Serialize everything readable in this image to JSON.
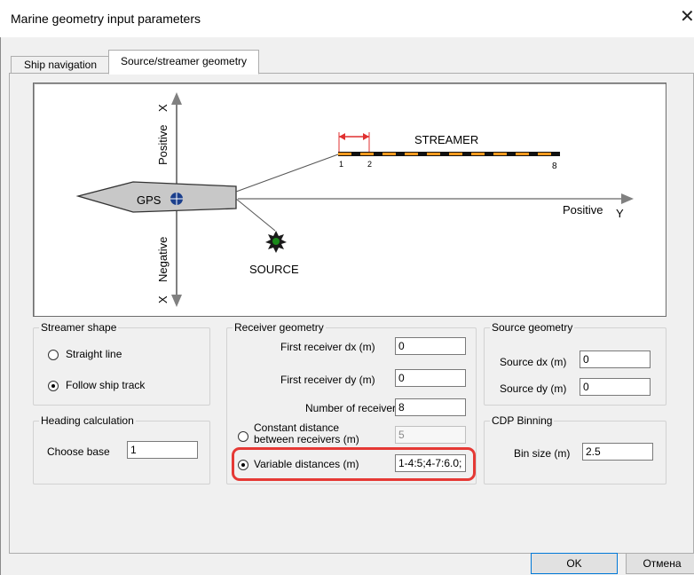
{
  "window": {
    "title": "Marine geometry input parameters",
    "close_glyph": "✕"
  },
  "tabs": [
    {
      "label": "Ship navigation",
      "selected": false
    },
    {
      "label": "Source/streamer geometry",
      "selected": true
    }
  ],
  "diagram": {
    "x_positive_label": "Positive",
    "x_negative_label": "Negative",
    "x_axis_letter_top": "X",
    "x_axis_letter_bottom": "X",
    "y_positive_label": "Positive",
    "y_axis_letter": "Y",
    "gps_label": "GPS",
    "source_label": "SOURCE",
    "streamer_label": "STREAMER",
    "receiver_labels": [
      "1",
      "2",
      "8"
    ],
    "colors": {
      "streamer_dash": "#ff9a1e",
      "arrow": "#e03030",
      "source": "#1a8a1a",
      "gps": "#1b3f8c",
      "ship_fill": "#c8c8c8",
      "axis": "#808080"
    }
  },
  "streamer_shape": {
    "legend": "Streamer shape",
    "options": [
      {
        "label": "Straight line",
        "selected": false
      },
      {
        "label": "Follow ship track",
        "selected": true
      }
    ]
  },
  "heading_calculation": {
    "legend": "Heading calculation",
    "choose_base_label": "Choose base",
    "choose_base_value": "1"
  },
  "receiver_geometry": {
    "legend": "Receiver geometry",
    "first_dx_label": "First receiver dx (m)",
    "first_dx_value": "0",
    "first_dy_label": "First receiver dy (m)",
    "first_dy_value": "0",
    "num_receivers_label": "Number of receivers",
    "num_receivers_value": "8",
    "constant_label_line1": "Constant distance",
    "constant_label_line2": "between receivers (m)",
    "constant_value": "5",
    "constant_selected": false,
    "variable_label": "Variable distances (m)",
    "variable_value": "1-4:5;4-7:6.0;",
    "variable_selected": true
  },
  "source_geometry": {
    "legend": "Source geometry",
    "dx_label": "Source dx (m)",
    "dx_value": "0",
    "dy_label": "Source dy (m)",
    "dy_value": "0"
  },
  "cdp_binning": {
    "legend": "CDP Binning",
    "bin_size_label": "Bin size (m)",
    "bin_size_value": "2.5"
  },
  "buttons": {
    "ok": "OK",
    "cancel": "Отмена"
  }
}
